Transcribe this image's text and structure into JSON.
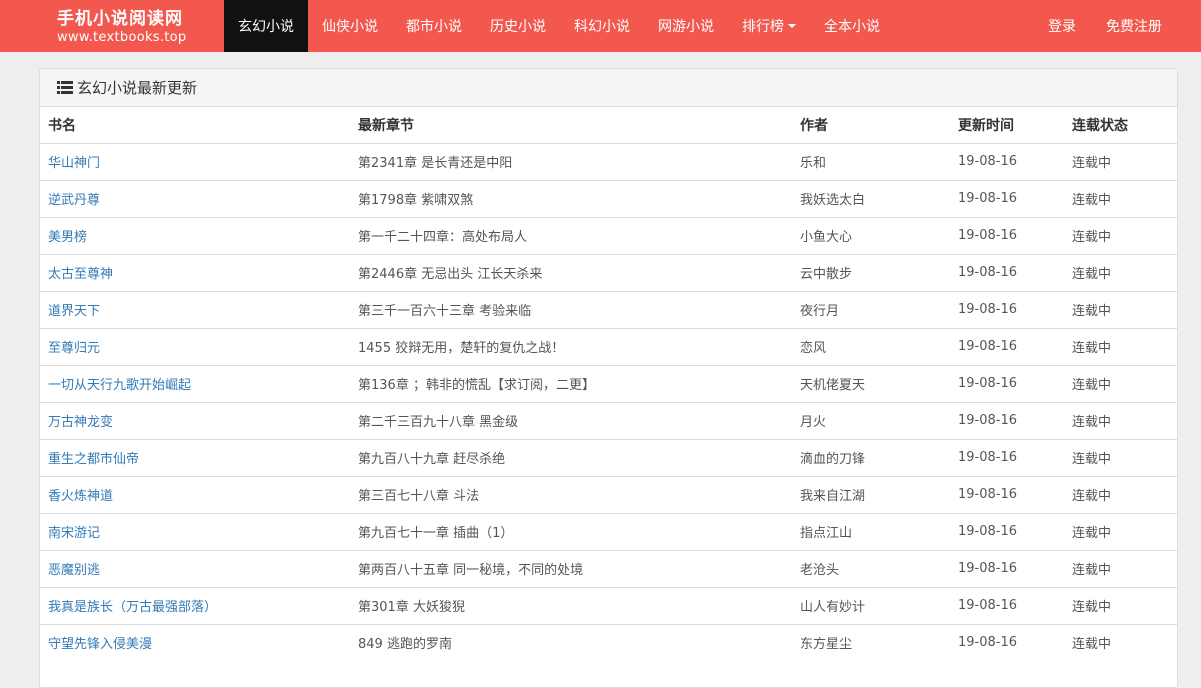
{
  "brand": {
    "title": "手机小说阅读网",
    "url": "www.textbooks.top"
  },
  "nav": {
    "items": [
      {
        "label": "玄幻小说",
        "active": true
      },
      {
        "label": "仙侠小说"
      },
      {
        "label": "都市小说"
      },
      {
        "label": "历史小说"
      },
      {
        "label": "科幻小说"
      },
      {
        "label": "网游小说"
      },
      {
        "label": "排行榜",
        "dropdown": true
      },
      {
        "label": "全本小说"
      }
    ],
    "login": "登录",
    "register": "免费注册"
  },
  "panel": {
    "heading": "玄幻小说最新更新",
    "icon": "list-icon"
  },
  "table": {
    "headers": [
      "书名",
      "最新章节",
      "作者",
      "更新时间",
      "连载状态"
    ],
    "rows": [
      {
        "title": "华山神门",
        "chapter": "第2341章 是长青还是中阳",
        "author": "乐和",
        "date": "19-08-16",
        "status": "连载中"
      },
      {
        "title": "逆武丹尊",
        "chapter": "第1798章 紫啸双煞",
        "author": "我妖选太白",
        "date": "19-08-16",
        "status": "连载中"
      },
      {
        "title": "美男榜",
        "chapter": "第一千二十四章：高处布局人",
        "author": "小鱼大心",
        "date": "19-08-16",
        "status": "连载中"
      },
      {
        "title": "太古至尊神",
        "chapter": "第2446章 无忌出头 江长天杀来",
        "author": "云中散步",
        "date": "19-08-16",
        "status": "连载中"
      },
      {
        "title": "道界天下",
        "chapter": "第三千一百六十三章 考验来临",
        "author": "夜行月",
        "date": "19-08-16",
        "status": "连载中"
      },
      {
        "title": "至尊归元",
        "chapter": "1455 狡辩无用，楚轩的复仇之战！",
        "author": "恋风",
        "date": "19-08-16",
        "status": "连载中"
      },
      {
        "title": "一切从天行九歌开始崛起",
        "chapter": "第136章 ；韩非的慌乱【求订阅，二更】",
        "author": "天机佬夏天",
        "date": "19-08-16",
        "status": "连载中"
      },
      {
        "title": "万古神龙变",
        "chapter": "第二千三百九十八章 黑金级",
        "author": "月火",
        "date": "19-08-16",
        "status": "连载中"
      },
      {
        "title": "重生之都市仙帝",
        "chapter": "第九百八十九章 赶尽杀绝",
        "author": "滴血的刀锋",
        "date": "19-08-16",
        "status": "连载中"
      },
      {
        "title": "香火炼神道",
        "chapter": "第三百七十八章 斗法",
        "author": "我来自江湖",
        "date": "19-08-16",
        "status": "连载中"
      },
      {
        "title": "南宋游记",
        "chapter": "第九百七十一章 插曲（1）",
        "author": "指点江山",
        "date": "19-08-16",
        "status": "连载中"
      },
      {
        "title": "恶魔别逃",
        "chapter": "第两百八十五章 同一秘境，不同的处境",
        "author": "老沧头",
        "date": "19-08-16",
        "status": "连载中"
      },
      {
        "title": "我真是族长（万古最强部落）",
        "chapter": "第301章 大妖狻猊",
        "author": "山人有妙计",
        "date": "19-08-16",
        "status": "连载中"
      },
      {
        "title": "守望先锋入侵美漫",
        "chapter": "849 逃跑的罗南",
        "author": "东方星尘",
        "date": "19-08-16",
        "status": "连载中"
      }
    ]
  },
  "colors": {
    "navbar": "#f2584d",
    "active_tab": "#111111",
    "link": "#337ab7"
  }
}
